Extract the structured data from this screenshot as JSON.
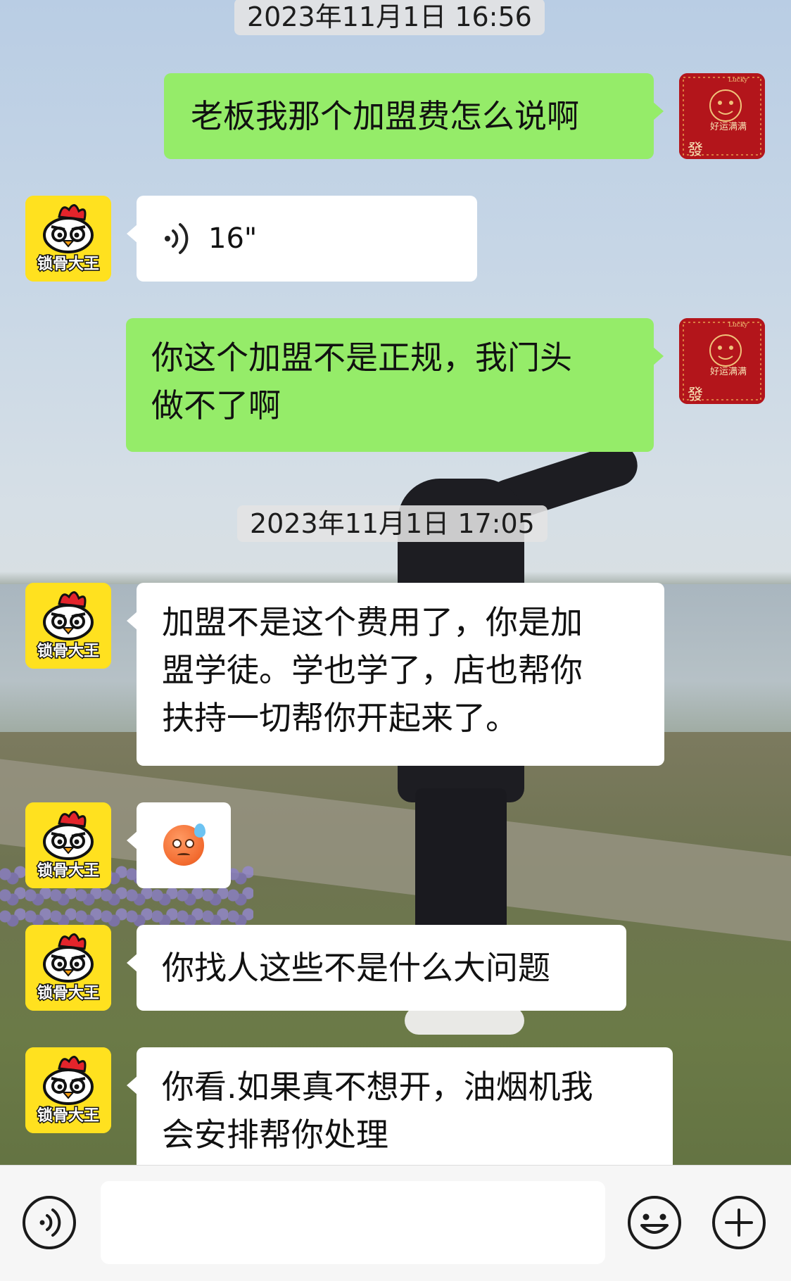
{
  "chat": {
    "timestamps": [
      "2023年11月1日 16:56",
      "2023年11月1日 17:05"
    ],
    "messages": [
      {
        "side": "right",
        "type": "text",
        "text": "老板我那个加盟费怎么说啊"
      },
      {
        "side": "left",
        "type": "voice",
        "duration": "16\""
      },
      {
        "side": "right",
        "type": "text",
        "lines": [
          "你这个加盟不是正规，我门头",
          "做不了啊"
        ]
      },
      {
        "side": "left",
        "type": "text",
        "lines": [
          "加盟不是这个费用了，你是加",
          "盟学徒。学也学了，店也帮你",
          "扶持一切帮你开起来了。"
        ]
      },
      {
        "side": "left",
        "type": "emoji",
        "emoji": "sweat-face-emoji"
      },
      {
        "side": "left",
        "type": "text",
        "text": "你找人这些不是什么大问题"
      },
      {
        "side": "left",
        "type": "text",
        "lines": [
          "你看.如果真不想开，油烟机我",
          "会安排帮你处理"
        ]
      }
    ]
  },
  "contact": {
    "avatar_text": "锁骨大王",
    "avatar_color": "#ffe11f"
  },
  "me": {
    "avatar_text_top": "Lucky",
    "avatar_text_mid": "好运满满",
    "avatar_text_bottom": "發",
    "avatar_color": "#b3151b"
  },
  "input_bar": {
    "input_value": "",
    "icons": [
      "voice-icon",
      "emoji-icon",
      "plus-icon"
    ]
  },
  "colors": {
    "bubble_green": "#95ec69",
    "bubble_white": "#ffffff",
    "input_bar_bg": "#f6f6f6"
  }
}
